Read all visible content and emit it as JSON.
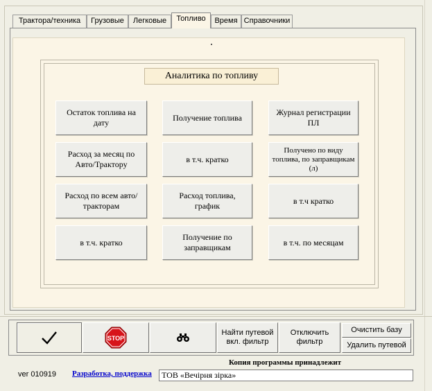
{
  "tabs": [
    {
      "label": "Трактора/техника"
    },
    {
      "label": "Грузовые"
    },
    {
      "label": "Легковые"
    },
    {
      "label": "Топливо"
    },
    {
      "label": "Время"
    },
    {
      "label": "Справочники"
    }
  ],
  "active_tab": "Топливо",
  "panel": {
    "title": "Аналитика по топливу",
    "buttons": [
      {
        "label": "Остаток топлива на дату"
      },
      {
        "label": "Получение топлива"
      },
      {
        "label": "Журнал регистрации ПЛ"
      },
      {
        "label": "Расход за месяц по Авто/Трактору"
      },
      {
        "label": "в т.ч. кратко"
      },
      {
        "label": "Получено по виду топлива,  по заправщикам (л)"
      },
      {
        "label": "Расход по всем авто/тракторам"
      },
      {
        "label": "Расход топлива, график"
      },
      {
        "label": "в т.ч  кратко"
      },
      {
        "label": "в т.ч. кратко"
      },
      {
        "label": "Получение по заправщикам"
      },
      {
        "label": "в т.ч. по месяцам"
      }
    ]
  },
  "toolbar": {
    "stop_label": "STOP",
    "find_waybill_label": "Найти путевой вкл. фильтр",
    "disable_filter_label": "Отключить фильтр",
    "clear_db_label": "Очистить базу",
    "delete_waybill_label": "Удалить путевой"
  },
  "footer": {
    "version": "ver 010919",
    "dev_link": "Разработка, поддержка",
    "copy_label": "Копия программы принадлежит",
    "owner": "ТОВ «Вечірня зірка»"
  },
  "colors": {
    "window_bg": "#f0efe5",
    "panel_bg": "#fbf5e6",
    "stop_red": "#d7141a",
    "link_blue": "#0000cc"
  }
}
